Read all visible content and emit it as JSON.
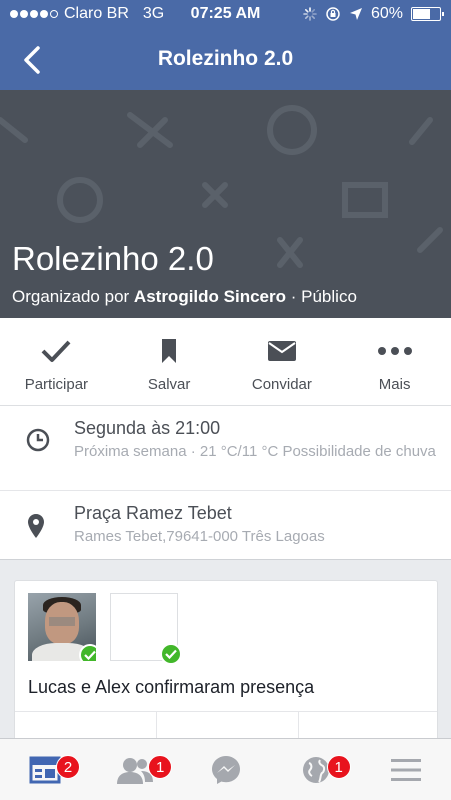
{
  "status_bar": {
    "carrier": "Claro BR",
    "network": "3G",
    "time": "07:25 AM",
    "battery": "60%",
    "battery_level": 0.6
  },
  "nav": {
    "title": "Rolezinho 2.0"
  },
  "event": {
    "title": "Rolezinho 2.0",
    "organized_by": "Organizado por",
    "organizer": "Astrogildo Sincero",
    "separator": "·",
    "privacy": "Público"
  },
  "actions": [
    {
      "label": "Participar",
      "icon": "checkmark-icon"
    },
    {
      "label": "Salvar",
      "icon": "bookmark-icon"
    },
    {
      "label": "Convidar",
      "icon": "envelope-icon"
    },
    {
      "label": "Mais",
      "icon": "more-dots-icon"
    }
  ],
  "details": {
    "time_primary": "Segunda às 21:00",
    "time_secondary": "Próxima semana · 21 °C/11 °C Possibilidade de chuva",
    "place_primary": "Praça Ramez Tebet",
    "place_secondary": "Rames Tebet,79641-000 Três Lagoas"
  },
  "attendees": {
    "text": "Lucas e Alex confirmaram presença"
  },
  "tabs": [
    {
      "name": "news-feed",
      "icon": "news-feed-icon",
      "badge": "2"
    },
    {
      "name": "friend-requests",
      "icon": "friends-icon",
      "badge": "1"
    },
    {
      "name": "messenger",
      "icon": "messenger-icon",
      "badge": ""
    },
    {
      "name": "notifications",
      "icon": "globe-icon",
      "badge": "1"
    },
    {
      "name": "more",
      "icon": "menu-icon",
      "badge": ""
    }
  ],
  "colors": {
    "header_blue": "#4a6aa7",
    "cover_gray": "#4b515a",
    "badge_red": "#e8131d",
    "check_green": "#42b72a",
    "active_tab_blue": "#4267b2"
  }
}
